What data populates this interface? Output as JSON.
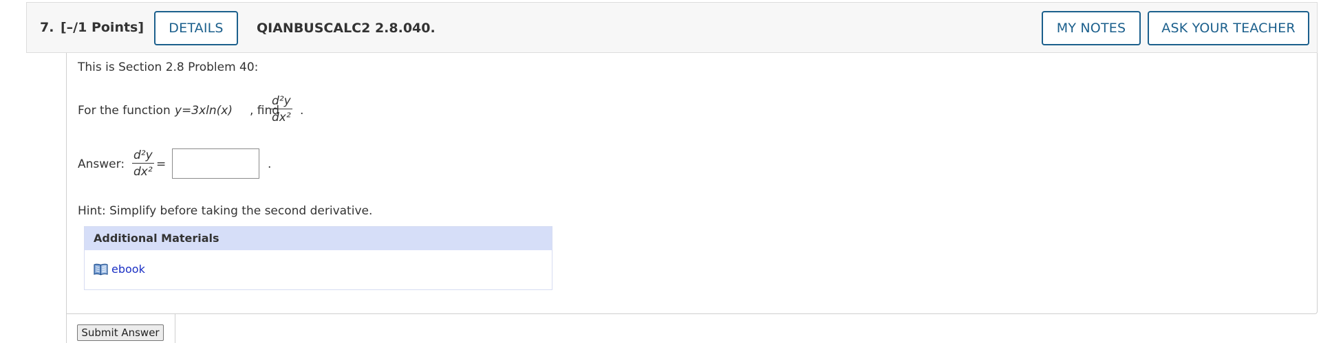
{
  "header": {
    "question_number": "7.",
    "points": "[–/1 Points]",
    "details_label": "DETAILS",
    "question_code": "QIANBUSCALC2 2.8.040.",
    "my_notes_label": "MY NOTES",
    "ask_teacher_label": "ASK YOUR TEACHER"
  },
  "content": {
    "intro": "This is Section 2.8 Problem 40:",
    "question_lead": "For the function",
    "function_text": "y=3xln(x)",
    "question_after": ", find",
    "derivative_numerator": "d²y",
    "derivative_denominator": "dx²",
    "question_end": ".",
    "answer_label": "Answer:",
    "equals_sign": "=",
    "answer_value": "",
    "answer_end": ".",
    "hint": "Hint: Simplify before taking the second derivative."
  },
  "materials": {
    "title": "Additional Materials",
    "link_label": "ebook",
    "icon": "book-icon"
  },
  "submit": {
    "label": "Submit Answer"
  },
  "colors": {
    "accent": "#1b5f8c",
    "link": "#1a2fc4",
    "materials_header_bg": "#d6def8"
  }
}
